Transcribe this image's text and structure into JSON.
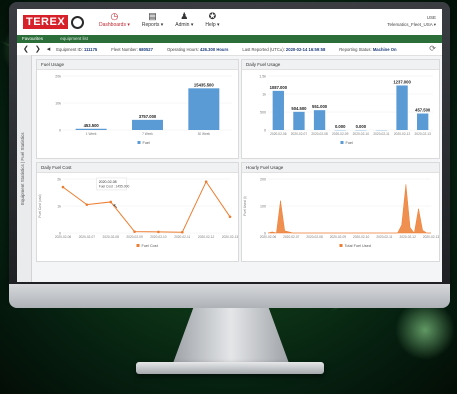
{
  "app": {
    "logo_text": "TEREX",
    "nav": [
      {
        "label": "Dashboards ▾",
        "icon": "dashboard-icon",
        "active": true
      },
      {
        "label": "Reports ▾",
        "icon": "reports-icon",
        "active": false
      },
      {
        "label": "Admin ▾",
        "icon": "admin-icon",
        "active": false
      },
      {
        "label": "Help ▾",
        "icon": "help-icon",
        "active": false
      }
    ],
    "user": {
      "line1": "USE",
      "line2": "Telematics_Fleet_USA ▾"
    }
  },
  "tabs": {
    "active": "Favourites",
    "second": "equipment list"
  },
  "infobar": {
    "nav_prev_first": "❮",
    "nav_next": "❯",
    "nav_back": "◂",
    "items": [
      {
        "label": "Equipment ID:",
        "value": "111175"
      },
      {
        "label": "Fleet Number:",
        "value": "680527"
      },
      {
        "label": "Operating Hours:",
        "value": "426.300 Hours"
      },
      {
        "label": "Last Reported (UTC±):",
        "value": "2020-02-14 16:59:58"
      },
      {
        "label": "Reporting Status:",
        "value": "Machine On"
      }
    ],
    "refresh_icon": "refresh-icon"
  },
  "sidebar": {
    "label": "Equipment Statistics | Fuel Statistics"
  },
  "colors": {
    "bar": "#5b9bd5",
    "line": "#ed7d31",
    "brand_red": "#d6202a",
    "green": "#2c6e3a"
  },
  "panels": {
    "fuel_usage": {
      "title": "Fuel Usage",
      "chart_data": {
        "type": "bar",
        "categories": [
          "1 Week",
          "7 Week",
          "30 Week"
        ],
        "values": [
          453.5,
          3757.0,
          15435.5
        ],
        "value_labels": [
          "453.500",
          "3757.000",
          "15435.500"
        ],
        "yticks": [
          "20k",
          "10k",
          "0"
        ],
        "ylim": [
          0,
          20000
        ],
        "legend": "Fuel"
      }
    },
    "daily_fuel_usage": {
      "title": "Daily Fuel Usage",
      "chart_data": {
        "type": "bar",
        "categories": [
          "2020-02-06",
          "2020-02-07",
          "2020-02-08",
          "2020-02-09",
          "2020-02-10",
          "2020-02-11",
          "2020-02-12",
          "2020-02-13"
        ],
        "values": [
          1087,
          504.5,
          551,
          0,
          0,
          0,
          1237,
          457.5
        ],
        "value_labels": [
          "1087.000",
          "504.500",
          "551.000",
          "0.000",
          "0.000",
          "",
          "1237.000",
          "457.500"
        ],
        "yticks": [
          "1.5k",
          "1k",
          "500",
          "0"
        ],
        "ylim": [
          0,
          1500
        ],
        "legend": "Fuel"
      }
    },
    "daily_fuel_cost": {
      "title": "Daily Fuel Cost",
      "chart_data": {
        "type": "line",
        "categories": [
          "2020-02-06",
          "2020-02-07",
          "2020-02-08",
          "2020-02-09",
          "2020-02-10",
          "2020-02-11",
          "2020-02-12",
          "2020-02-13"
        ],
        "values": [
          1700,
          1050,
          1150,
          50,
          40,
          30,
          1900,
          600
        ],
        "yticks": [
          "2k",
          "1k",
          "0"
        ],
        "ylim": [
          0,
          2000
        ],
        "ylabel": "Fuel Cost (usd)",
        "legend": "Fuel Cost",
        "tooltip": {
          "date": "2020-02-08",
          "text": "Fuel Cost : 1455.000"
        }
      }
    },
    "hourly_fuel_usage": {
      "title": "Hourly Fuel Usage",
      "chart_data": {
        "type": "area",
        "categories": [
          "2020-02-06",
          "2020-02-07",
          "2020-02-08",
          "2020-02-09",
          "2020-02-10",
          "2020-02-11",
          "2020-02-12",
          "2020-02-13"
        ],
        "values": [
          0,
          4,
          0,
          120,
          8,
          4,
          0,
          0,
          0,
          0,
          0,
          0,
          0,
          0,
          0,
          0,
          0,
          0,
          0,
          0,
          0,
          0,
          0,
          0,
          0,
          0,
          0,
          0,
          0,
          0,
          0,
          0,
          30,
          180,
          20,
          0,
          90,
          10,
          0,
          0
        ],
        "yticks": [
          "200",
          "100",
          "0"
        ],
        "ylim": [
          0,
          200
        ],
        "ylabel": "Fuel Used (l)",
        "legend": "Total Fuel Used"
      }
    }
  }
}
